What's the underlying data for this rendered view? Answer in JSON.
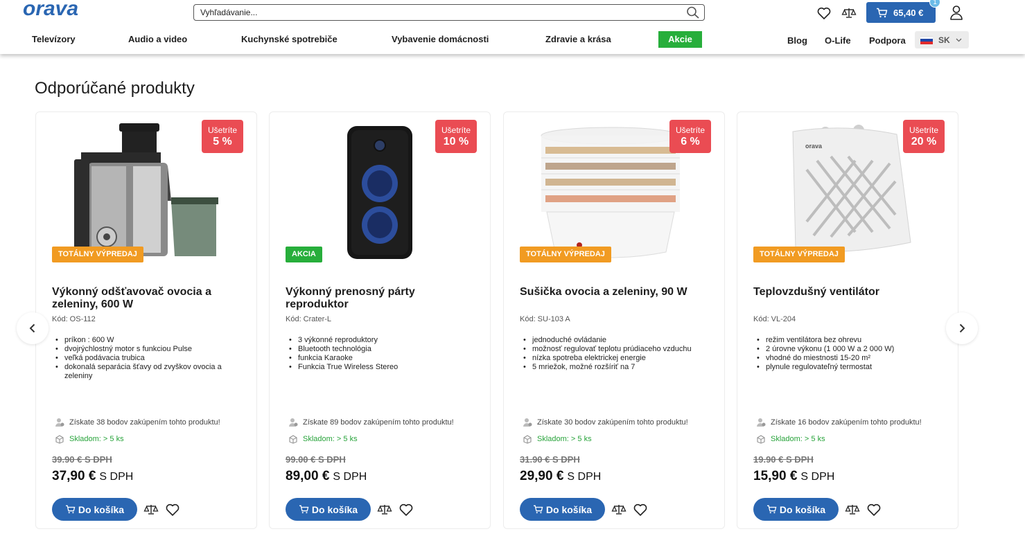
{
  "brand": {
    "logo_text": "orava",
    "logo_color": "#2a66b2"
  },
  "search": {
    "placeholder": "Vyhľadávanie..."
  },
  "cart": {
    "total": "65,40 €",
    "count": "1"
  },
  "nav": {
    "items": [
      "Televízory",
      "Audio a video",
      "Kuchynské spotrebiče",
      "Vybavenie domácnosti",
      "Zdravie a krása"
    ],
    "akcie": "Akcie",
    "right": [
      "Blog",
      "O-Life",
      "Podpora"
    ],
    "lang": "SK"
  },
  "section": {
    "title": "Odporúčané produkty"
  },
  "colors": {
    "accent": "#2a66b2",
    "discount": "#ea4c53",
    "sale_orange": "#f19b22",
    "green": "#27ae3b"
  },
  "products": [
    {
      "save_label": "Ušetríte",
      "save_value": "5 %",
      "tag": "TOTÁLNY VÝPREDAJ",
      "tag_color": "orange",
      "name": "Výkonný odšťavovač ovocia a zeleniny, 600 W",
      "code": "Kód: OS-112",
      "features": [
        "príkon : 600 W",
        "dvojrýchlostný motor s funkciou Pulse",
        "veľká podávacia trubica",
        "dokonalá separácia šťavy od zvyškov ovocia a zeleniny"
      ],
      "points": "Získate 38 bodov zakúpením tohto produktu!",
      "stock": "Skladom: > 5 ks",
      "old_price": "39.90 € S DPH",
      "price": "37,90 €",
      "price_suffix": "S DPH",
      "button": "Do košíka"
    },
    {
      "save_label": "Ušetríte",
      "save_value": "10 %",
      "tag": "AKCIA",
      "tag_color": "green",
      "name": "Výkonný prenosný párty reproduktor",
      "code": "Kód: Crater-L",
      "features": [
        "3 výkonné reproduktory",
        "Bluetooth technológia",
        "funkcia Karaoke",
        "Funkcia True Wireless Stereo"
      ],
      "points": "Získate 89 bodov zakúpením tohto produktu!",
      "stock": "Skladom: > 5 ks",
      "old_price": "99.00 € S DPH",
      "price": "89,00 €",
      "price_suffix": "S DPH",
      "button": "Do košíka"
    },
    {
      "save_label": "Ušetríte",
      "save_value": "6 %",
      "tag": "TOTÁLNY VÝPREDAJ",
      "tag_color": "orange",
      "name": "Sušička ovocia a zeleniny, 90 W",
      "code": "Kód: SU-103 A",
      "features": [
        "jednoduché ovládanie",
        "možnosť regulovať teplotu prúdiaceho vzduchu",
        "nízka spotreba elektrickej energie",
        "5 mriežok, možné rozšíriť na 7"
      ],
      "points": "Získate 30 bodov zakúpením tohto produktu!",
      "stock": "Skladom: > 5 ks",
      "old_price": "31.90 € S DPH",
      "price": "29,90 €",
      "price_suffix": "S DPH",
      "button": "Do košíka"
    },
    {
      "save_label": "Ušetríte",
      "save_value": "20 %",
      "tag": "TOTÁLNY VÝPREDAJ",
      "tag_color": "orange",
      "name": "Teplovzdušný ventilátor",
      "code": "Kód: VL-204",
      "features": [
        "režim ventilátora bez ohrevu",
        "2 úrovne výkonu (1 000 W a 2 000 W)",
        "vhodné do miestnosti 15-20 m²",
        "plynule regulovateľný termostat"
      ],
      "points": "Získate 16 bodov zakúpením tohto produktu!",
      "stock": "Skladom: > 5 ks",
      "old_price": "19.90 € S DPH",
      "price": "15,90 €",
      "price_suffix": "S DPH",
      "button": "Do košíka"
    }
  ]
}
